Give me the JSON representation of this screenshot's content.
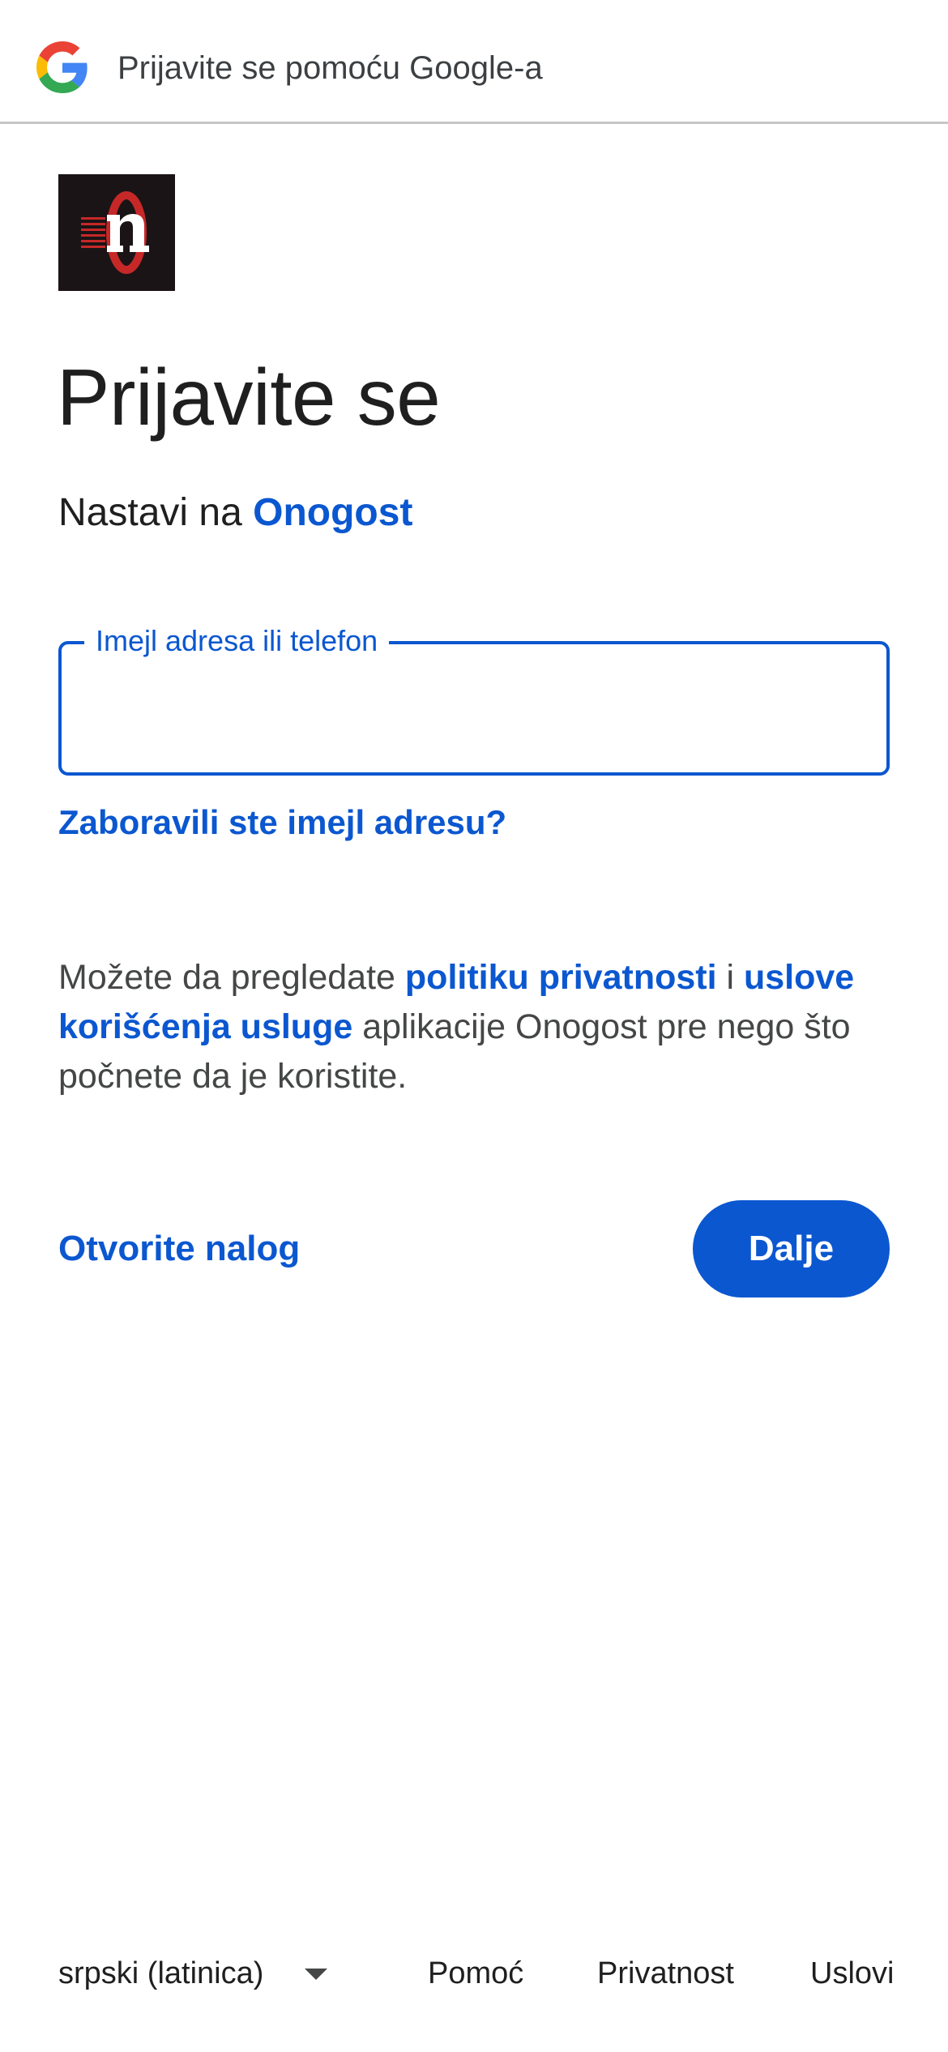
{
  "header": {
    "title": "Prijavite se pomoću Google-a",
    "logo_icon": "google-g-icon"
  },
  "app": {
    "logo_icon": "onogost-logo-icon",
    "logo_colors": {
      "background": "#1b1416",
      "accent": "#c62828",
      "letter": "#ffffff"
    }
  },
  "main": {
    "heading": "Prijavite se",
    "subtitle_prefix": "Nastavi na",
    "app_name": "Onogost",
    "email_field": {
      "label": "Imejl adresa ili telefon",
      "value": "",
      "placeholder": ""
    },
    "forgot_link": "Zaboravili ste imejl adresu?",
    "policy": {
      "text_1": "Možete da pregledate ",
      "privacy_link": "politiku privatnosti",
      "text_2": " i ",
      "terms_link": "uslove korišćenja usluge",
      "text_3": " aplikacije Onogost pre nego što počnete da je koristite."
    },
    "create_account_link": "Otvorite nalog",
    "next_button": "Dalje"
  },
  "footer": {
    "language": "srpski (latinica)",
    "help": "Pomoć",
    "privacy": "Privatnost",
    "terms": "Uslovi"
  },
  "colors": {
    "accent": "#0b57d0",
    "text": "#1f1f1f",
    "secondary_text": "#444746",
    "divider": "#c6c6c6"
  }
}
